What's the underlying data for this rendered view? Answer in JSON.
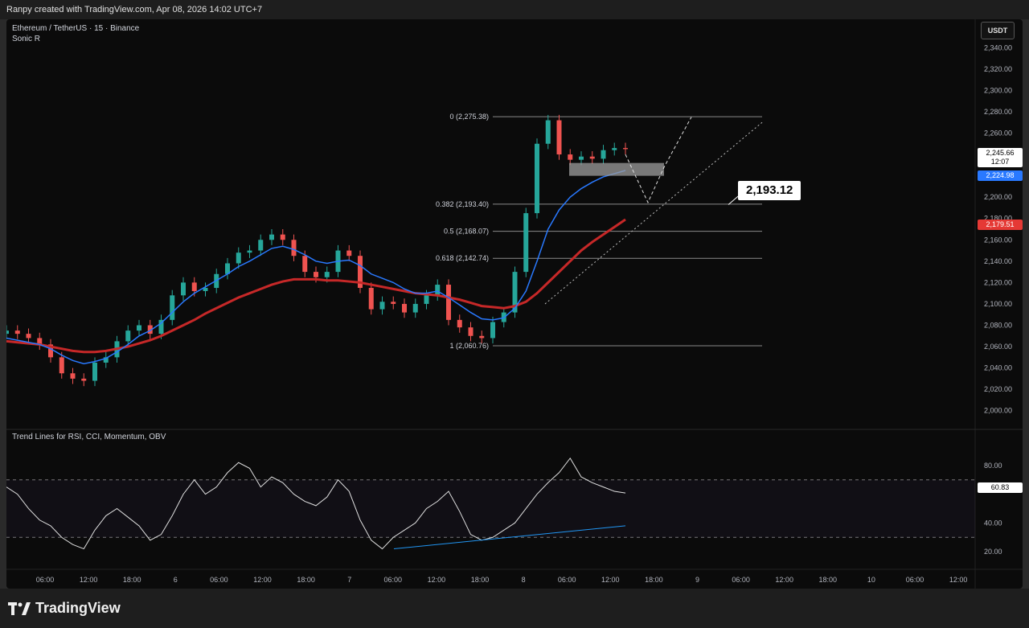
{
  "header": {
    "credit": "Ranpy created with TradingView.com, Apr 08, 2026 14:02 UTC+7"
  },
  "legend": {
    "symbol": "Ethereum / TetherUS · 15 · Binance",
    "indicator": "Sonic R"
  },
  "price_axis": {
    "unit": "USDT",
    "ticks": [
      "2,340.00",
      "2,320.00",
      "2,300.00",
      "2,280.00",
      "2,260.00",
      "2,240.00",
      "2,220.00",
      "2,200.00",
      "2,180.00",
      "2,160.00",
      "2,140.00",
      "2,120.00",
      "2,100.00",
      "2,080.00",
      "2,060.00",
      "2,040.00",
      "2,020.00",
      "2,000.00"
    ],
    "tick_values": [
      2340,
      2320,
      2300,
      2280,
      2260,
      2240,
      2220,
      2200,
      2180,
      2160,
      2140,
      2120,
      2100,
      2080,
      2060,
      2040,
      2020,
      2000
    ]
  },
  "price_tags": {
    "last": {
      "price": "2,245.66",
      "countdown": "12:07",
      "value": 2245.66,
      "color": "#ffffff"
    },
    "ema_fast": {
      "label": "2,224.98",
      "value": 2224.98,
      "color": "#2979ff"
    },
    "ema_slow": {
      "label": "2,179.51",
      "value": 2179.51,
      "color": "#e53935"
    }
  },
  "fib_levels": [
    {
      "label": "0 (2,275.38)",
      "value": 2275.38
    },
    {
      "label": "0.382 (2,193.40)",
      "value": 2193.4
    },
    {
      "label": "0.5 (2,168.07)",
      "value": 2168.07
    },
    {
      "label": "0.618 (2,142.74)",
      "value": 2142.74
    },
    {
      "label": "1 (2,060.76)",
      "value": 2060.76
    }
  ],
  "callout": {
    "label": "2,193.12"
  },
  "oscillator": {
    "title": "Trend Lines for RSI, CCI, Momentum, OBV",
    "ticks": [
      "80.00",
      "40.00",
      "20.00"
    ],
    "tick_values": [
      80,
      40,
      20
    ],
    "bands": [
      70,
      30
    ],
    "current": {
      "label": "60.83",
      "value": 60.83
    }
  },
  "time_axis": [
    "06:00",
    "12:00",
    "18:00",
    "6",
    "06:00",
    "12:00",
    "18:00",
    "7",
    "06:00",
    "12:00",
    "18:00",
    "8",
    "06:00",
    "12:00",
    "18:00",
    "9",
    "06:00",
    "12:00",
    "18:00",
    "10",
    "06:00",
    "12:00"
  ],
  "brand": {
    "name": "TradingView"
  },
  "colors": {
    "up": "#26a69a",
    "down": "#ef5350",
    "ema_fast": "#2979ff",
    "ema_slow": "#c62828",
    "background": "#0b0b0b"
  },
  "chart_data": {
    "type": "candlestick",
    "series": [
      {
        "name": "ETHUSDT 15m (approx. closes)",
        "values": [
          2075,
          2072,
          2068,
          2062,
          2050,
          2035,
          2030,
          2028,
          2045,
          2050,
          2065,
          2075,
          2080,
          2072,
          2085,
          2108,
          2120,
          2112,
          2115,
          2128,
          2138,
          2148,
          2150,
          2160,
          2165,
          2160,
          2145,
          2130,
          2125,
          2130,
          2150,
          2145,
          2115,
          2095,
          2102,
          2100,
          2092,
          2100,
          2108,
          2118,
          2085,
          2078,
          2070,
          2068,
          2083,
          2092,
          2130,
          2185,
          2250,
          2272,
          2240,
          2235,
          2238,
          2236,
          2244,
          2246,
          2245
        ]
      },
      {
        "name": "Sonic R fast EMA (approx.)",
        "values": [
          2068,
          2066,
          2064,
          2062,
          2058,
          2052,
          2047,
          2044,
          2046,
          2049,
          2055,
          2062,
          2070,
          2075,
          2082,
          2092,
          2102,
          2110,
          2116,
          2122,
          2128,
          2135,
          2140,
          2146,
          2152,
          2154,
          2151,
          2146,
          2140,
          2138,
          2140,
          2141,
          2136,
          2128,
          2124,
          2120,
          2114,
          2110,
          2110,
          2112,
          2106,
          2099,
          2092,
          2086,
          2085,
          2087,
          2096,
          2112,
          2140,
          2170,
          2188,
          2200,
          2208,
          2214,
          2219,
          2222,
          2225
        ]
      },
      {
        "name": "Sonic R slow EMA (approx.)",
        "values": [
          2065,
          2064,
          2063,
          2062,
          2060,
          2058,
          2056,
          2055,
          2055,
          2056,
          2058,
          2060,
          2063,
          2066,
          2070,
          2075,
          2080,
          2085,
          2091,
          2096,
          2101,
          2106,
          2110,
          2114,
          2118,
          2121,
          2123,
          2123,
          2123,
          2122,
          2122,
          2121,
          2120,
          2118,
          2116,
          2114,
          2112,
          2110,
          2109,
          2108,
          2106,
          2104,
          2101,
          2098,
          2097,
          2096,
          2098,
          2102,
          2110,
          2120,
          2130,
          2140,
          2150,
          2158,
          2165,
          2172,
          2179
        ]
      }
    ],
    "oscillator_values": [
      65,
      60,
      50,
      42,
      38,
      30,
      25,
      22,
      35,
      45,
      50,
      44,
      38,
      28,
      32,
      45,
      60,
      70,
      60,
      65,
      75,
      82,
      78,
      65,
      72,
      68,
      60,
      55,
      52,
      58,
      70,
      62,
      42,
      28,
      22,
      30,
      35,
      40,
      50,
      55,
      62,
      48,
      32,
      28,
      30,
      35,
      40,
      50,
      60,
      68,
      75,
      85,
      72,
      68,
      65,
      62,
      60.83
    ],
    "ylim": [
      1990,
      2350
    ],
    "osc_ylim": [
      10,
      95
    ]
  }
}
